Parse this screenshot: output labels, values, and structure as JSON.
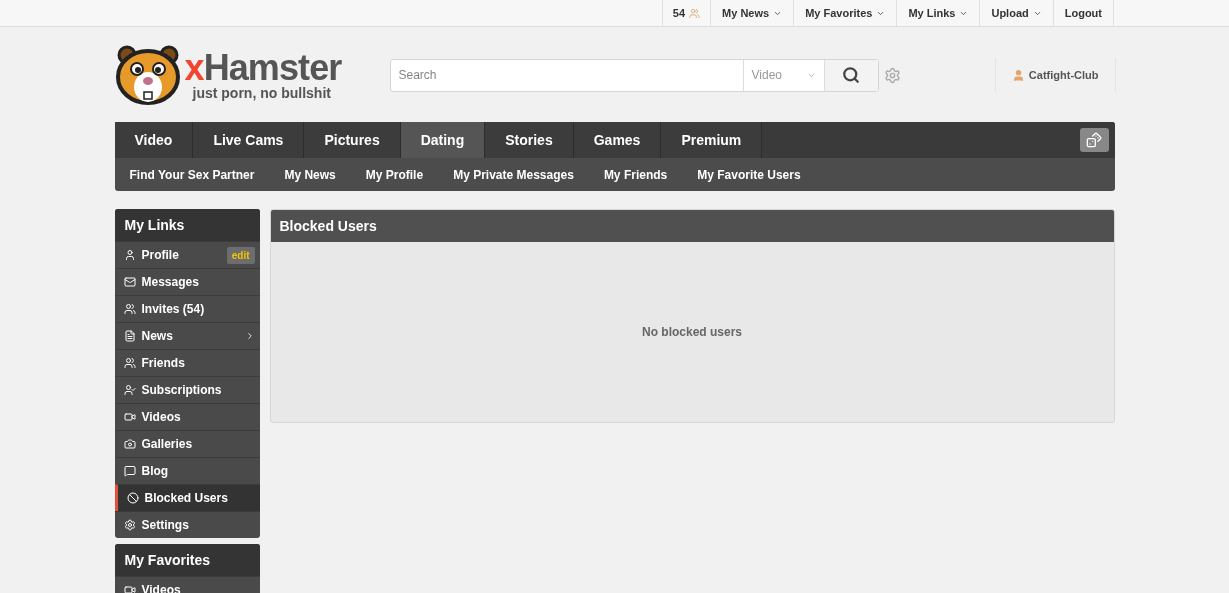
{
  "top_bar": {
    "count": "54",
    "items": [
      {
        "label": "My News",
        "has_menu": true
      },
      {
        "label": "My Favorites",
        "has_menu": true
      },
      {
        "label": "My Links",
        "has_menu": true
      },
      {
        "label": "Upload",
        "has_menu": true
      },
      {
        "label": "Logout",
        "has_menu": false
      }
    ]
  },
  "logo": {
    "name": "xHamster",
    "slogan": "just porn, no bullshit"
  },
  "search": {
    "placeholder": "Search",
    "category": "Video"
  },
  "user": {
    "name": "Catfight-Club"
  },
  "main_nav": [
    {
      "label": "Video",
      "selected": false
    },
    {
      "label": "Live Cams",
      "selected": false
    },
    {
      "label": "Pictures",
      "selected": false
    },
    {
      "label": "Dating",
      "selected": true
    },
    {
      "label": "Stories",
      "selected": false
    },
    {
      "label": "Games",
      "selected": false
    },
    {
      "label": "Premium",
      "selected": false
    }
  ],
  "sub_nav": [
    "Find Your Sex Partner",
    "My News",
    "My Profile",
    "My Private Messages",
    "My Friends",
    "My Favorite Users"
  ],
  "sidebar": {
    "title": "My Links",
    "items": [
      {
        "label": "Profile",
        "selected": false,
        "badge": "edit"
      },
      {
        "label": "Messages",
        "selected": false
      },
      {
        "label": "Invites (54)",
        "selected": false
      },
      {
        "label": "News",
        "selected": false,
        "submenu": true
      },
      {
        "label": "Friends",
        "selected": false
      },
      {
        "label": "Subscriptions",
        "selected": false
      },
      {
        "label": "Videos",
        "selected": false
      },
      {
        "label": "Galleries",
        "selected": false
      },
      {
        "label": "Blog",
        "selected": false
      },
      {
        "label": "Blocked Users",
        "selected": true
      },
      {
        "label": "Settings",
        "selected": false
      }
    ]
  },
  "favorites": {
    "title": "My Favorites",
    "items": [
      {
        "label": "Videos"
      }
    ]
  },
  "panel": {
    "title": "Blocked Users",
    "message": "No blocked users"
  }
}
